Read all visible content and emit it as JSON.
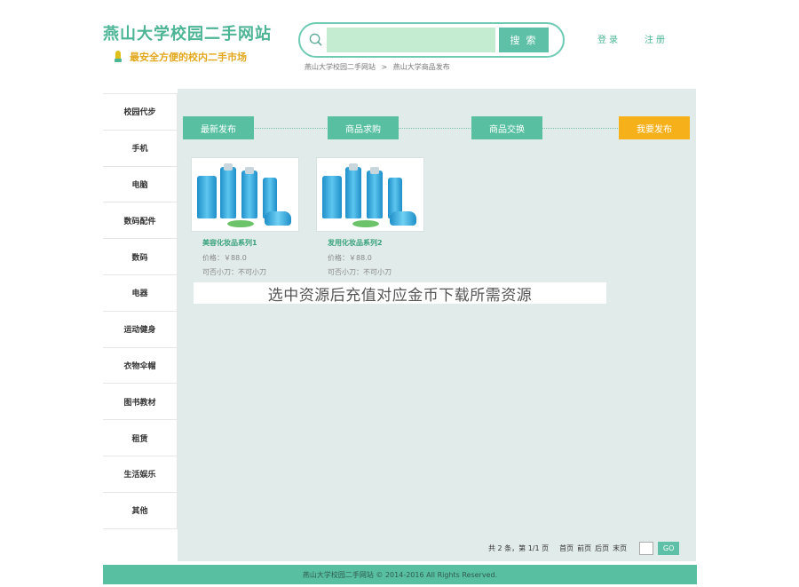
{
  "header": {
    "site_title": "燕山大学校园二手网站",
    "site_slogan": "最安全方便的校内二手市场",
    "search": {
      "value": "",
      "placeholder": "",
      "button_label": "搜 索"
    },
    "breadcrumb": [
      "燕山大学校园二手网站",
      ">",
      "燕山大学商品发布"
    ],
    "login_label": "登录",
    "register_label": "注册"
  },
  "sidebar": {
    "items": [
      "校园代步",
      "手机",
      "电脑",
      "数码配件",
      "数码",
      "电器",
      "运动健身",
      "衣物伞帽",
      "图书教材",
      "租赁",
      "生活娱乐",
      "其他"
    ]
  },
  "tabs": [
    {
      "label": "最新发布",
      "active": false
    },
    {
      "label": "商品求购",
      "active": false
    },
    {
      "label": "商品交换",
      "active": false
    },
    {
      "label": "我要发布",
      "active": true
    }
  ],
  "products": [
    {
      "title": "美容化妆品系列1",
      "price": "价格：￥88.0",
      "bargain": "可否小刀：不可小刀"
    },
    {
      "title": "发用化妆品系列2",
      "price": "价格：￥88.0",
      "bargain": "可否小刀：不可小刀"
    }
  ],
  "watermark": "选中资源后充值对应金币下载所需资源",
  "pager": {
    "summary": "共 2 条，第 1/1 页",
    "first": "首页",
    "prev": "前页",
    "next": "后页",
    "last": "末页",
    "go_label": "GO"
  },
  "footer": {
    "text": "燕山大学校园二手网站 © 2014-2016 All Rights Reserved."
  },
  "colors": {
    "accent": "#58c0a1",
    "highlight": "#f5b01a",
    "panel": "#e1ebea",
    "title": "#4db596"
  }
}
